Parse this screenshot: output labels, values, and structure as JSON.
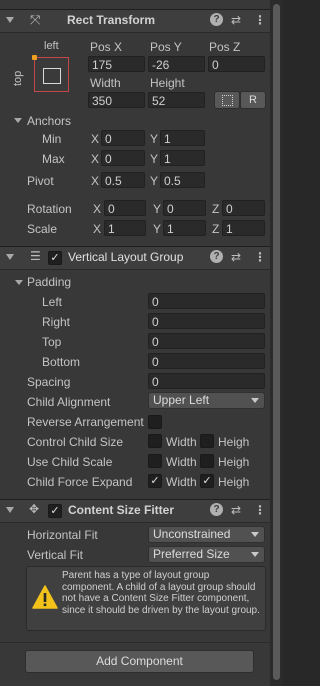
{
  "rect_transform": {
    "title": "Rect Transform",
    "anchor_preset": {
      "horizontal": "left",
      "vertical": "top"
    },
    "pos_x_label": "Pos X",
    "pos_y_label": "Pos Y",
    "pos_z_label": "Pos Z",
    "pos_x": "175",
    "pos_y": "-26",
    "pos_z": "0",
    "width_label": "Width",
    "height_label": "Height",
    "width": "350",
    "height": "52",
    "raw_edit_button": "R",
    "anchors_label": "Anchors",
    "min_label": "Min",
    "max_label": "Max",
    "min_x": "0",
    "min_y": "1",
    "max_x": "0",
    "max_y": "1",
    "pivot_label": "Pivot",
    "pivot_x": "0.5",
    "pivot_y": "0.5",
    "rotation_label": "Rotation",
    "rot_x": "0",
    "rot_y": "0",
    "rot_z": "0",
    "scale_label": "Scale",
    "scale_x": "1",
    "scale_y": "1",
    "scale_z": "1",
    "x": "X",
    "y": "Y",
    "z": "Z"
  },
  "vertical_layout_group": {
    "title": "Vertical Layout Group",
    "enabled": true,
    "padding_label": "Padding",
    "left_label": "Left",
    "left": "0",
    "right_label": "Right",
    "right": "0",
    "top_label": "Top",
    "top": "0",
    "bottom_label": "Bottom",
    "bottom": "0",
    "spacing_label": "Spacing",
    "spacing": "0",
    "child_alignment_label": "Child Alignment",
    "child_alignment": "Upper Left",
    "reverse_arrangement_label": "Reverse Arrangement",
    "reverse_arrangement": false,
    "control_child_size_label": "Control Child Size",
    "control_child_size_width": false,
    "control_child_size_height": false,
    "use_child_scale_label": "Use Child Scale",
    "use_child_scale_width": false,
    "use_child_scale_height": false,
    "child_force_expand_label": "Child Force Expand",
    "child_force_expand_width": true,
    "child_force_expand_height": true,
    "width_label": "Width",
    "height_label": "Heigh"
  },
  "content_size_fitter": {
    "title": "Content Size Fitter",
    "enabled": true,
    "horizontal_fit_label": "Horizontal Fit",
    "horizontal_fit": "Unconstrained",
    "vertical_fit_label": "Vertical Fit",
    "vertical_fit": "Preferred Size",
    "warning_text": "Parent has a type of layout group component. A child of a layout group should not have a Content Size Fitter component, since it should be driven by the layout group."
  },
  "add_component_label": "Add Component",
  "colors": {
    "panel": "#383838",
    "header": "#3e3e3e",
    "field": "#2a2a2a",
    "warning": "#f2c21a"
  }
}
